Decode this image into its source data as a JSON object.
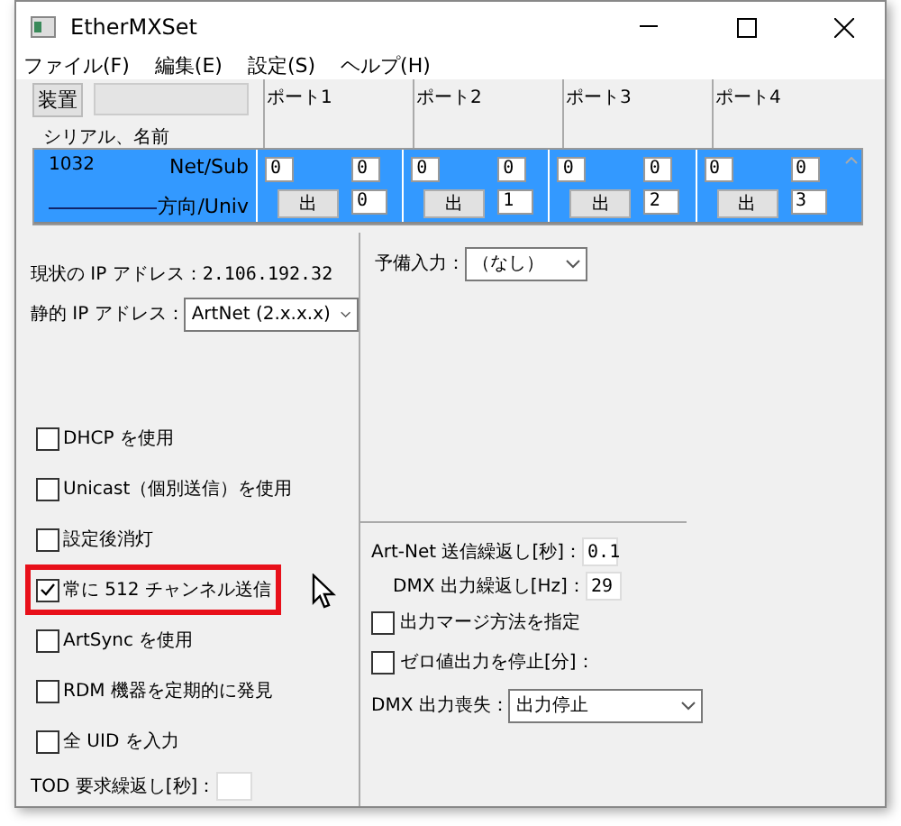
{
  "window": {
    "title": "EtherMXSet"
  },
  "menu": [
    {
      "label": "ファイル(F)"
    },
    {
      "label": "編集(E)"
    },
    {
      "label": "設定(S)"
    },
    {
      "label": "ヘルプ(H)"
    }
  ],
  "device_table": {
    "device_button": "装置",
    "name_header": "シリアル、名前",
    "columns": [
      "ポート1",
      "ポート2",
      "ポート3",
      "ポート4"
    ],
    "rows": [
      {
        "serial": "1032",
        "selected": true,
        "net_sub_label": "Net/Sub",
        "direction_label": "方向/Univ",
        "ports": [
          {
            "net": "0",
            "sub": "0",
            "direction": "出",
            "universe": "0"
          },
          {
            "net": "0",
            "sub": "0",
            "direction": "出",
            "universe": "1"
          },
          {
            "net": "0",
            "sub": "0",
            "direction": "出",
            "universe": "2"
          },
          {
            "net": "0",
            "sub": "0",
            "direction": "出",
            "universe": "3"
          }
        ]
      }
    ]
  },
  "network": {
    "current_ip_label": "現状の IP アドレス：",
    "current_ip": "2.106.192.32",
    "static_ip_label": "静的 IP アドレス：",
    "static_ip_value": "ArtNet (2.x.x.x)"
  },
  "options": [
    {
      "label": "DHCP を使用",
      "checked": false,
      "highlighted": false
    },
    {
      "label": "Unicast（個別送信）を使用",
      "checked": false,
      "highlighted": false
    },
    {
      "label": "設定後消灯",
      "checked": false,
      "highlighted": false
    },
    {
      "label": "常に 512 チャンネル送信",
      "checked": true,
      "highlighted": true
    },
    {
      "label": "ArtSync を使用",
      "checked": false,
      "highlighted": false
    },
    {
      "label": "RDM 機器を定期的に発見",
      "checked": false,
      "highlighted": false
    },
    {
      "label": "全 UID を入力",
      "checked": false,
      "highlighted": false
    }
  ],
  "tod": {
    "label": "TOD 要求繰返し[秒]："
  },
  "spare_input": {
    "label": "予備入力：",
    "value": "（なし）"
  },
  "output": {
    "artnet_repeat_label": "Art-Net 送信繰返し[秒]：",
    "artnet_repeat_value": "0.1",
    "dmx_repeat_label": "DMX 出力繰返し[Hz]：",
    "dmx_repeat_value": "29",
    "options": [
      {
        "label": "出力マージ方法を指定",
        "checked": false
      },
      {
        "label": "ゼロ値出力を停止[分]：",
        "checked": false
      }
    ],
    "dmx_loss_label": "DMX 出力喪失：",
    "dmx_loss_value": "出力停止"
  }
}
